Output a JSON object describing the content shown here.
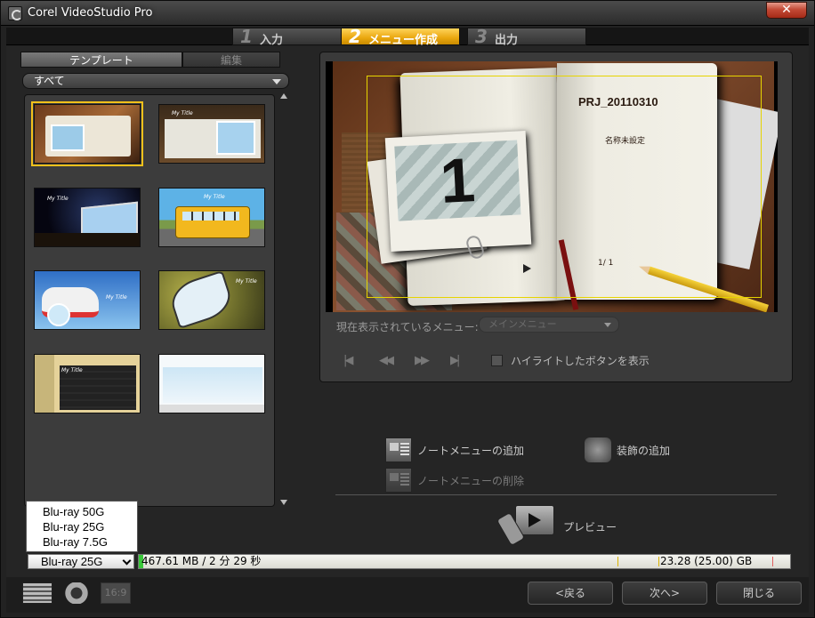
{
  "window": {
    "title": "Corel VideoStudio Pro",
    "close_label": "✕"
  },
  "steps": [
    {
      "num": "1",
      "label": "入力"
    },
    {
      "num": "2",
      "label": "メニュー作成"
    },
    {
      "num": "3",
      "label": "出力"
    }
  ],
  "left_panel": {
    "tabs": [
      "テンプレート",
      "編集"
    ],
    "filter_value": "すべて",
    "thumb_labels": [
      "My Title",
      "My Title",
      "My Title",
      "My Title",
      "My Title",
      "My Title"
    ]
  },
  "preview": {
    "project_title": "PRJ_20110310",
    "subtitle": "名称未設定",
    "photo_number": "1",
    "page_indicator": "1/ 1",
    "current_menu_label": "現在表示されているメニュー:",
    "current_menu_value": "メインメニュー",
    "nav": [
      "|◀",
      "◀◀",
      "▶▶",
      "▶|"
    ],
    "highlight_label": "ハイライトしたボタンを表示"
  },
  "actions": {
    "add_note_menu": "ノートメニューの追加",
    "delete_note_menu": "ノートメニューの削除",
    "add_decoration": "装飾の追加",
    "preview": "プレビュー"
  },
  "disc": {
    "options": [
      "Blu-ray 50G",
      "Blu-ray 25G",
      "Blu-ray 7.5G"
    ],
    "selected": "Blu-ray 25G",
    "used": "467.61 MB /  2 分 29 秒",
    "total": "23.28 (25.00) GB",
    "used_fraction": 0.007
  },
  "bottom": {
    "ratio_label": "16:9",
    "back": "<戻る",
    "next": "次へ>",
    "close": "閉じる"
  }
}
